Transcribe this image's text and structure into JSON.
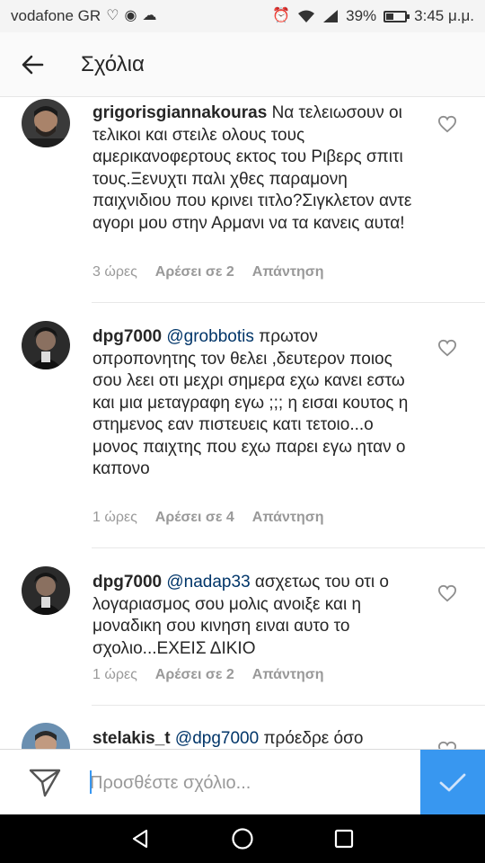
{
  "status_bar": {
    "carrier": "vodafone GR",
    "battery": "39%",
    "battery_level": 0.39,
    "time": "3:45 μ.μ."
  },
  "header": {
    "title": "Σχόλια"
  },
  "comments": [
    {
      "username": "grigorisgiannakouras",
      "text": "Να τελειωσουν οι τελικοι και στειλε ολους τους αμερικανοφερτους εκτος του Ριβερς σπιτι τους.Ξενυχτι παλι χθες παραμονη παιχνιδιου που κρινει τιτλο?Σιγκλετον αντε αγορι μου στην Αρμανι να τα κανεις αυτα!",
      "time": "3 ώρες",
      "likes": "Αρέσει σε 2",
      "reply": "Απάντηση"
    },
    {
      "username": "dpg7000",
      "mention": "@grobbotis",
      "text": "πρωτον οπροπονητης τον θελει ,δευτερον ποιος σου λεει οτι μεχρι σημερα εχω κανει εστω και μια μεταγραφη εγω ;;; η εισαι κουτος η στημενος εαν πιστευεις κατι τετοιο...ο μονος παιχτης που εχω παρει εγω ηταν ο καπονο",
      "time": "1 ώρες",
      "likes": "Αρέσει σε 4",
      "reply": "Απάντηση"
    },
    {
      "username": "dpg7000",
      "mention": "@nadap33",
      "text": "ασχετως του οτι ο λογαριασμος σου μολις ανοιξε και η μοναδικη σου κινηση ειναι αυτο το σχολιο...ΕΧΕΙΣ ΔΙΚΙΟ",
      "time": "1 ώρες",
      "likes": "Αρέσει σε 2",
      "reply": "Απάντηση"
    },
    {
      "username": "stelakis_t",
      "mention": "@dpg7000",
      "text": "πρόεδρε όσο"
    }
  ],
  "comment_input": {
    "placeholder": "Προσθέστε σχόλιο..."
  }
}
